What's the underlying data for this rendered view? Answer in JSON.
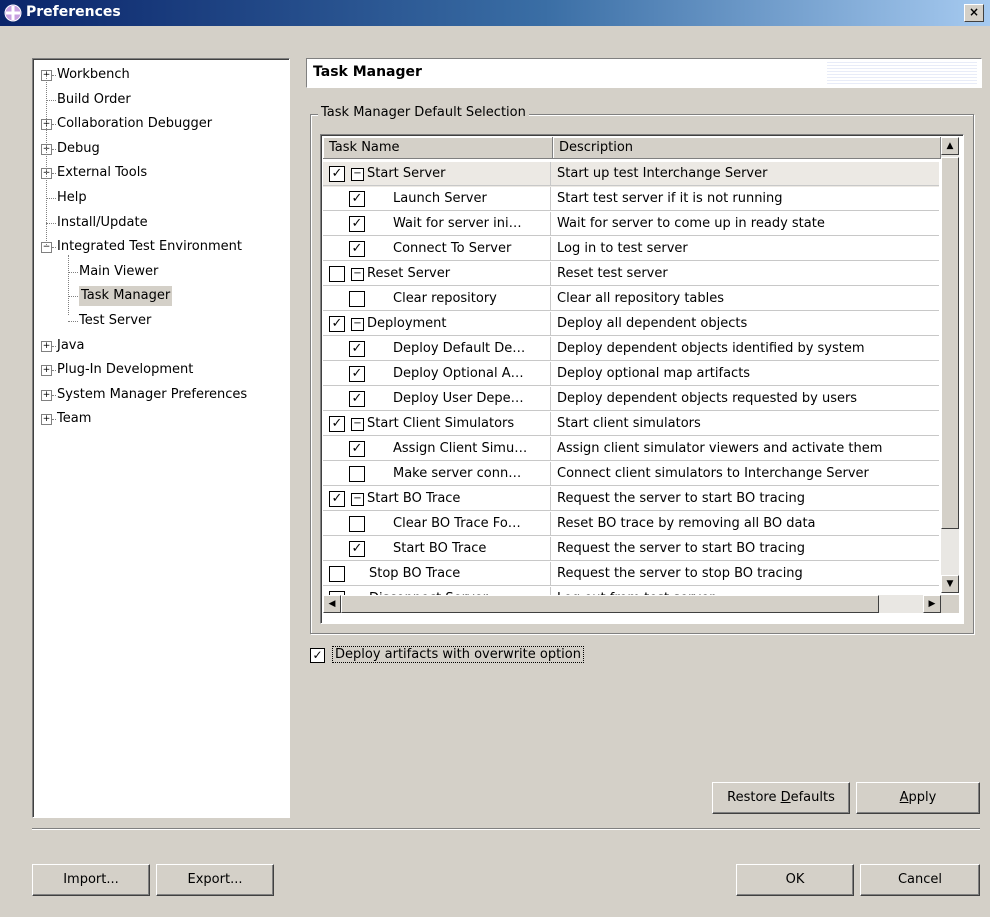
{
  "window": {
    "title": "Preferences",
    "close": "×"
  },
  "tree": {
    "items": [
      {
        "label": "Workbench",
        "expander": "+"
      },
      {
        "label": "Build Order",
        "expander": ""
      },
      {
        "label": "Collaboration Debugger",
        "expander": "+"
      },
      {
        "label": "Debug",
        "expander": "+"
      },
      {
        "label": "External Tools",
        "expander": "+"
      },
      {
        "label": "Help",
        "expander": ""
      },
      {
        "label": "Install/Update",
        "expander": ""
      },
      {
        "label": "Integrated Test Environment",
        "expander": "−"
      },
      {
        "label": "Main Viewer",
        "expander": ""
      },
      {
        "label": "Task Manager",
        "expander": "",
        "selected": true
      },
      {
        "label": "Test Server",
        "expander": ""
      },
      {
        "label": "Java",
        "expander": "+"
      },
      {
        "label": "Plug-In Development",
        "expander": "+"
      },
      {
        "label": "System Manager Preferences",
        "expander": "+"
      },
      {
        "label": "Team",
        "expander": "+"
      }
    ]
  },
  "panel": {
    "title": "Task Manager",
    "group_label": "Task Manager Default Selection"
  },
  "table": {
    "columns": [
      "Task Name",
      "Description"
    ],
    "rows": [
      {
        "name": "Start Server",
        "desc": "Start up test Interchange Server",
        "checked": true,
        "level": 0,
        "collapse": "−",
        "selected": true
      },
      {
        "name": "Launch Server",
        "desc": "Start test server if it is not running",
        "checked": true,
        "level": 1
      },
      {
        "name": "Wait for server ini…",
        "desc": "Wait for server to come up in ready state",
        "checked": true,
        "level": 1
      },
      {
        "name": "Connect To Server",
        "desc": "Log in to test server",
        "checked": true,
        "level": 1
      },
      {
        "name": "Reset Server",
        "desc": "Reset test server",
        "checked": false,
        "level": 0,
        "collapse": "−"
      },
      {
        "name": "Clear repository",
        "desc": "Clear all repository tables",
        "checked": false,
        "level": 1
      },
      {
        "name": "Deployment",
        "desc": "Deploy all dependent objects",
        "checked": true,
        "level": 0,
        "collapse": "−"
      },
      {
        "name": "Deploy Default De…",
        "desc": "Deploy dependent objects identified by system",
        "checked": true,
        "level": 1
      },
      {
        "name": "Deploy Optional A…",
        "desc": "Deploy optional map artifacts",
        "checked": true,
        "level": 1
      },
      {
        "name": "Deploy User Depe…",
        "desc": "Deploy dependent objects requested by users",
        "checked": true,
        "level": 1
      },
      {
        "name": "Start Client Simulators",
        "desc": "Start client simulators",
        "checked": true,
        "level": 0,
        "collapse": "−"
      },
      {
        "name": "Assign Client Simu…",
        "desc": "Assign client simulator viewers and activate them",
        "checked": true,
        "level": 1
      },
      {
        "name": "Make server conn…",
        "desc": "Connect client simulators to Interchange Server",
        "checked": false,
        "level": 1
      },
      {
        "name": "Start BO Trace",
        "desc": "Request the server to start BO tracing",
        "checked": true,
        "level": 0,
        "collapse": "−"
      },
      {
        "name": "Clear BO Trace Fo…",
        "desc": "Reset BO trace by removing all BO data",
        "checked": false,
        "level": 1
      },
      {
        "name": "Start BO Trace",
        "desc": "Request the server to start BO tracing",
        "checked": true,
        "level": 1
      },
      {
        "name": "Stop BO Trace",
        "desc": "Request the server to stop BO tracing",
        "checked": false,
        "level": 2
      },
      {
        "name": "Disconnect Server",
        "desc": "Log out from test server",
        "checked": false,
        "level": 2
      }
    ]
  },
  "deploy_option": {
    "label": "Deploy artifacts with overwrite option",
    "checked": true
  },
  "buttons": {
    "restore_pre": "Restore ",
    "restore_key": "D",
    "restore_post": "efaults",
    "apply_key": "A",
    "apply_post": "pply",
    "import": "Import...",
    "export": "Export...",
    "ok": "OK",
    "cancel": "Cancel"
  }
}
